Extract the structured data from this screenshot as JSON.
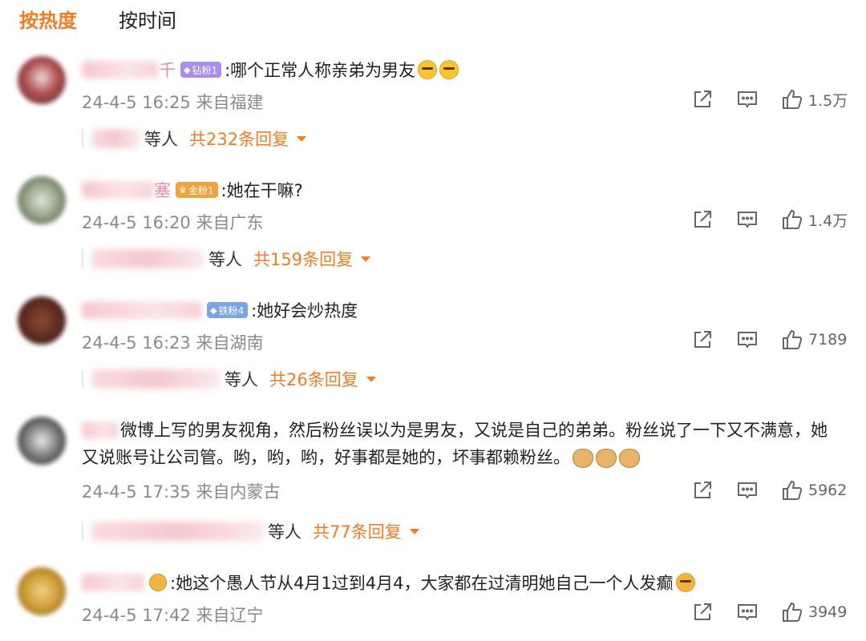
{
  "tabs": {
    "hot": "按热度",
    "time": "按时间"
  },
  "comments": [
    {
      "name_tail": "千",
      "badge": "钻粉1",
      "badge_color": "#a98df2",
      "text": ":哪个正常人称亲弟为男友",
      "time": "24-4-5 16:25",
      "location": "来自福建",
      "likes": "1.5万",
      "reply_etc": "等人",
      "reply_total": "共232条回复"
    },
    {
      "name_tail": "塞",
      "badge": "金粉1",
      "badge_color": "#f2a23a",
      "text": ":她在干嘛?",
      "time": "24-4-5 16:20",
      "location": "来自广东",
      "likes": "1.4万",
      "reply_etc": "等人",
      "reply_total": "共159条回复"
    },
    {
      "name_tail": "",
      "badge": "铁粉4",
      "badge_color": "#7aa6e8",
      "text": ":她好会炒热度",
      "time": "24-4-5 16:23",
      "location": "来自湖南",
      "likes": "7189",
      "reply_etc": "等人",
      "reply_total": "共26条回复"
    },
    {
      "name_tail": "",
      "badge": "",
      "text": "微博上写的男友视角，然后粉丝误以为是男友，又说是自己的弟弟。粉丝说了一下又不满意，她又说账号让公司管。哟，哟，哟，好事都是她的，坏事都赖粉丝。",
      "time": "24-4-5 17:35",
      "location": "来自内蒙古",
      "likes": "5962",
      "reply_etc": "等人",
      "reply_total": "共77条回复"
    },
    {
      "name_tail": "",
      "badge": "",
      "text": ":她这个愚人节从4月1过到4月4，大家都在过清明她自己一个人发癫",
      "time": "24-4-5 17:42",
      "location": "来自辽宁",
      "likes": "3949"
    }
  ],
  "icons": {
    "share": "share-icon",
    "comment": "comment-icon",
    "like": "thumbs-up-icon"
  },
  "colors": {
    "accent": "#f47b20",
    "meta": "#8a8a8a"
  }
}
